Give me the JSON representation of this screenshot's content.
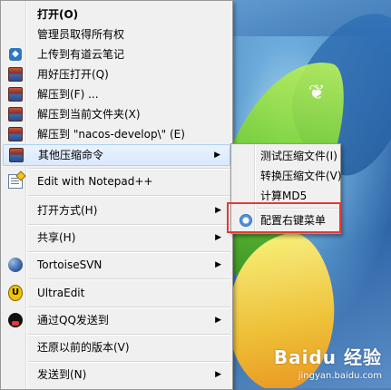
{
  "context_menu": {
    "items": [
      {
        "label": "打开(O)",
        "icon": "",
        "bold": true,
        "arrow": false
      },
      {
        "label": "管理员取得所有权",
        "icon": "",
        "bold": false,
        "arrow": false
      },
      {
        "label": "上传到有道云笔记",
        "icon": "youdao-note-icon",
        "bold": false,
        "arrow": false
      },
      {
        "label": "用好压打开(Q)",
        "icon": "winrar-archive-icon",
        "bold": false,
        "arrow": false
      },
      {
        "label": "解压到(F) ...",
        "icon": "winrar-archive-icon",
        "bold": false,
        "arrow": false
      },
      {
        "label": "解压到当前文件夹(X)",
        "icon": "winrar-archive-icon",
        "bold": false,
        "arrow": false
      },
      {
        "label": "解压到 \"nacos-develop\\\" (E)",
        "icon": "winrar-archive-icon",
        "bold": false,
        "arrow": false
      },
      {
        "label": "其他压缩命令",
        "icon": "winrar-archive-icon",
        "bold": false,
        "arrow": true,
        "highlighted": true
      },
      {
        "label": "Edit with Notepad++",
        "icon": "notepadpp-icon",
        "bold": false,
        "arrow": false
      },
      {
        "label": "打开方式(H)",
        "icon": "",
        "bold": false,
        "arrow": true
      },
      {
        "label": "共享(H)",
        "icon": "",
        "bold": false,
        "arrow": true
      },
      {
        "label": "TortoiseSVN",
        "icon": "tortoisesvn-icon",
        "bold": false,
        "arrow": true
      },
      {
        "label": "UltraEdit",
        "icon": "ultraedit-icon",
        "bold": false,
        "arrow": false
      },
      {
        "label": "通过QQ发送到",
        "icon": "qq-icon",
        "bold": false,
        "arrow": true
      },
      {
        "label": "还原以前的版本(V)",
        "icon": "",
        "bold": false,
        "arrow": false
      },
      {
        "label": "发送到(N)",
        "icon": "",
        "bold": false,
        "arrow": true
      }
    ]
  },
  "submenu": {
    "items": [
      {
        "label": "测试压缩文件(I)"
      },
      {
        "label": "转换压缩文件(V)"
      },
      {
        "label": "计算MD5"
      },
      {
        "label": "配置右键菜单",
        "icon": "gear-icon"
      }
    ]
  },
  "watermark": {
    "brand": "Baidu 经验",
    "url": "jingyan.baidu.com"
  },
  "colors": {
    "menu_bg": "#f0f0f0",
    "highlight_border": "#aecff7",
    "red_box": "#e53935"
  }
}
